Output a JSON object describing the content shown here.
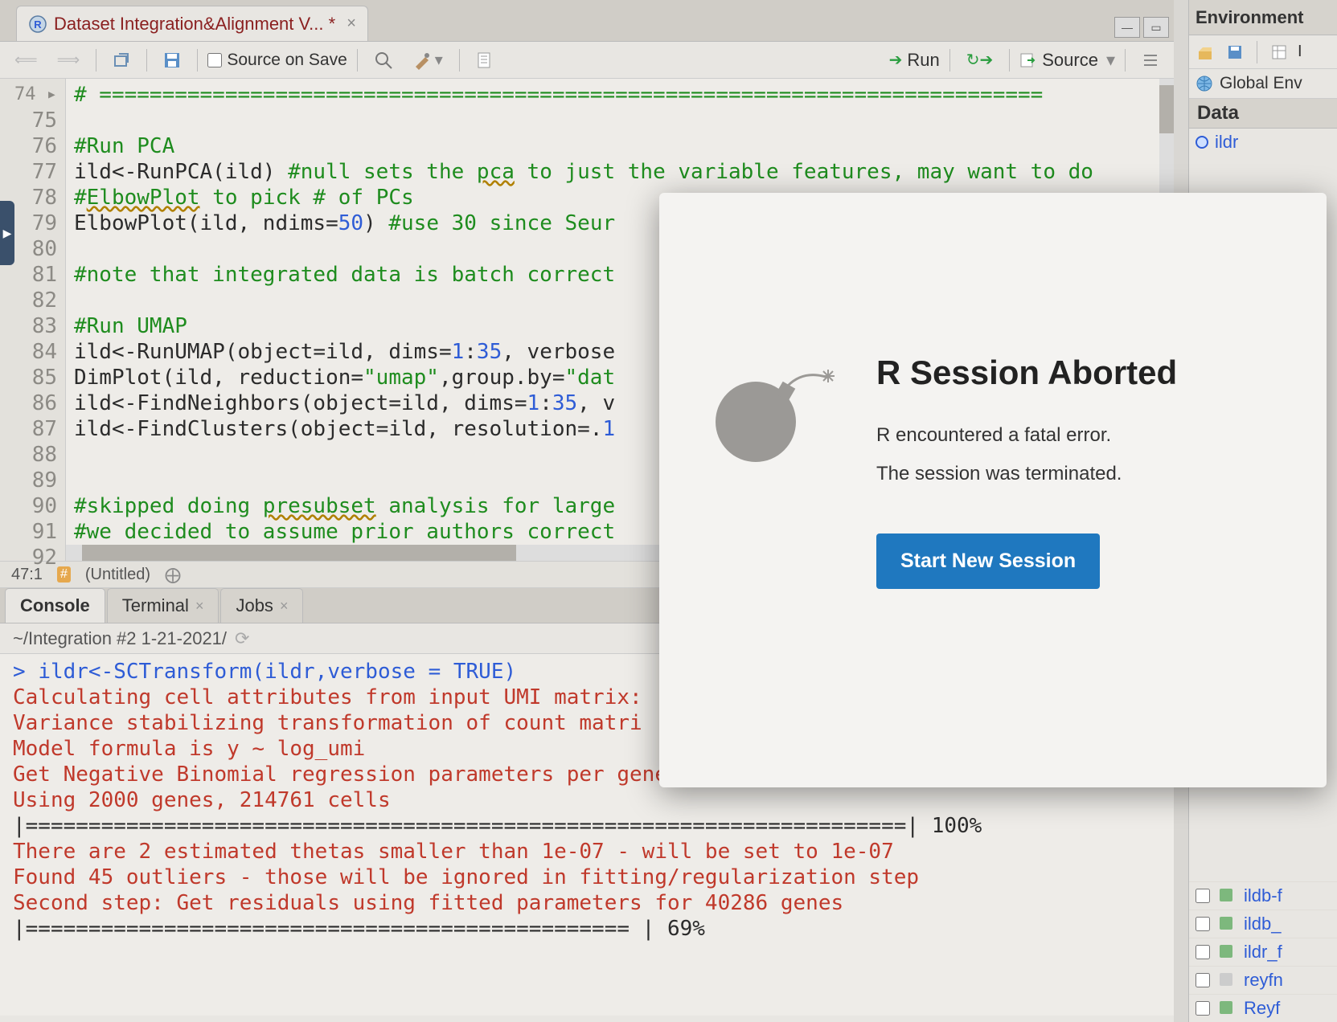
{
  "file_tab": {
    "title": "Dataset Integration&Alignment V... *"
  },
  "toolbar": {
    "source_on_save": "Source on Save",
    "run": "Run",
    "source": "Source"
  },
  "editor": {
    "first_line_no": 74,
    "lines": [
      {
        "n": 74,
        "segs": [
          {
            "t": "# ==========================================================================="
          }
        ],
        "cls": "comment"
      },
      {
        "n": 75,
        "segs": [
          {
            "t": ""
          }
        ]
      },
      {
        "n": 76,
        "segs": [
          {
            "t": "#Run PCA",
            "cls": "comment"
          }
        ]
      },
      {
        "n": 77,
        "segs": [
          {
            "t": "ild<-RunPCA(ild) "
          },
          {
            "t": "#null sets the ",
            "cls": "comment"
          },
          {
            "t": "pca",
            "cls": "comment underline"
          },
          {
            "t": " to just the variable features, may want to do",
            "cls": "comment"
          }
        ]
      },
      {
        "n": 78,
        "segs": [
          {
            "t": "#",
            "cls": "comment"
          },
          {
            "t": "ElbowPlot",
            "cls": "comment underline"
          },
          {
            "t": " to pick # of PCs",
            "cls": "comment"
          }
        ]
      },
      {
        "n": 79,
        "segs": [
          {
            "t": "ElbowPlot(ild, ndims="
          },
          {
            "t": "50",
            "cls": "num"
          },
          {
            "t": ") "
          },
          {
            "t": "#use 30 since Seur",
            "cls": "comment"
          }
        ]
      },
      {
        "n": 80,
        "segs": [
          {
            "t": ""
          }
        ]
      },
      {
        "n": 81,
        "segs": [
          {
            "t": "#note that integrated data is batch correct",
            "cls": "comment"
          }
        ]
      },
      {
        "n": 82,
        "segs": [
          {
            "t": ""
          }
        ]
      },
      {
        "n": 83,
        "segs": [
          {
            "t": "#Run UMAP",
            "cls": "comment"
          }
        ]
      },
      {
        "n": 84,
        "segs": [
          {
            "t": "ild<-RunUMAP(object=ild, dims="
          },
          {
            "t": "1",
            "cls": "num"
          },
          {
            "t": ":"
          },
          {
            "t": "35",
            "cls": "num"
          },
          {
            "t": ", verbose"
          }
        ]
      },
      {
        "n": 85,
        "segs": [
          {
            "t": "DimPlot(ild, reduction="
          },
          {
            "t": "\"umap\"",
            "cls": "str"
          },
          {
            "t": ",group.by="
          },
          {
            "t": "\"dat",
            "cls": "str"
          }
        ]
      },
      {
        "n": 86,
        "segs": [
          {
            "t": "ild<-FindNeighbors(object=ild, dims="
          },
          {
            "t": "1",
            "cls": "num"
          },
          {
            "t": ":"
          },
          {
            "t": "35",
            "cls": "num"
          },
          {
            "t": ", v"
          }
        ]
      },
      {
        "n": 87,
        "segs": [
          {
            "t": "ild<-FindClusters(object=ild, resolution=."
          },
          {
            "t": "1",
            "cls": "num"
          }
        ]
      },
      {
        "n": 88,
        "segs": [
          {
            "t": ""
          }
        ]
      },
      {
        "n": 89,
        "segs": [
          {
            "t": ""
          }
        ]
      },
      {
        "n": 90,
        "segs": [
          {
            "t": "#skipped doing ",
            "cls": "comment"
          },
          {
            "t": "presubset",
            "cls": "comment underline"
          },
          {
            "t": " analysis for large",
            "cls": "comment"
          }
        ]
      },
      {
        "n": 91,
        "segs": [
          {
            "t": "#we decided to assume prior authors correct",
            "cls": "comment"
          }
        ]
      },
      {
        "n": 92,
        "segs": [
          {
            "t": ""
          }
        ]
      }
    ],
    "cursor_pos": "47:1",
    "fn_label": "(Untitled)"
  },
  "bottom_tabs": {
    "console": "Console",
    "terminal": "Terminal",
    "jobs": "Jobs"
  },
  "console_path": "~/Integration #2 1-21-2021/",
  "console_lines": [
    {
      "t": "> ",
      "cls": "prompt"
    },
    {
      "t": "ildr<-SCTransform(ildr,verbose = TRUE)",
      "cls": "prompt",
      "br": true
    },
    {
      "t": "Calculating cell attributes from input UMI matrix:",
      "cls": "err",
      "br": true
    },
    {
      "t": "Variance stabilizing transformation of count matri",
      "cls": "err",
      "br": true
    },
    {
      "t": "Model formula is y ~ log_umi",
      "cls": "err",
      "br": true
    },
    {
      "t": "Get Negative Binomial regression parameters per gene",
      "cls": "err",
      "br": true
    },
    {
      "t": "Using 2000 genes, 214761 cells",
      "cls": "err",
      "br": true
    },
    {
      "t": "  |======================================================================| 100%",
      "cls": "",
      "br": true
    },
    {
      "t": "There are 2 estimated thetas smaller than 1e-07 - will be set to 1e-07",
      "cls": "err",
      "br": true
    },
    {
      "t": "Found 45 outliers - those will be ignored in fitting/regularization step",
      "cls": "err",
      "br": true
    },
    {
      "t": "",
      "br": true
    },
    {
      "t": "Second step: Get residuals using fitted parameters for 40286 genes",
      "cls": "err",
      "br": true
    },
    {
      "t": "  |================================================                      |  69%",
      "cls": "",
      "br": true
    }
  ],
  "side": {
    "env_tab": "Environment",
    "global_env": "Global Env",
    "import_label": "I",
    "data_header": "Data",
    "objects": [
      "ildr"
    ],
    "files": [
      "ildb-f",
      "ildb_",
      "ildr_f",
      "reyfn",
      "Reyf"
    ]
  },
  "dialog": {
    "title": "R Session Aborted",
    "line1": "R encountered a fatal error.",
    "line2": "The session was terminated.",
    "button": "Start New Session"
  }
}
